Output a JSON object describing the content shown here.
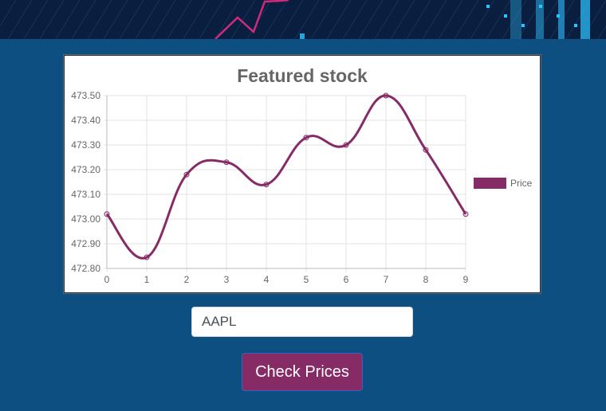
{
  "colors": {
    "page_background": "#0c4f80",
    "banner_background": "#0a1f40",
    "banner_line": "#d12a7a",
    "banner_accent": "#2ec4ff",
    "series_line": "#862b66",
    "button_background": "#862b66",
    "grid": "#e3e3e3",
    "text": "#666666"
  },
  "chart_data": {
    "type": "line",
    "title": "Featured stock",
    "x": [
      0,
      1,
      2,
      3,
      4,
      5,
      6,
      7,
      8,
      9
    ],
    "series": [
      {
        "name": "Price",
        "values": [
          473.02,
          472.845,
          473.18,
          473.23,
          473.14,
          473.33,
          473.3,
          473.5,
          473.28,
          473.02
        ]
      }
    ],
    "y_ticks": [
      "473.50",
      "473.40",
      "473.30",
      "473.20",
      "473.10",
      "473.00",
      "472.90",
      "472.80"
    ],
    "ylim": [
      472.8,
      473.5
    ],
    "xlim": [
      0,
      9
    ],
    "grid": true,
    "legend": "right",
    "smooth": true
  },
  "form": {
    "symbol_value": "AAPL",
    "button_label": "Check Prices"
  }
}
